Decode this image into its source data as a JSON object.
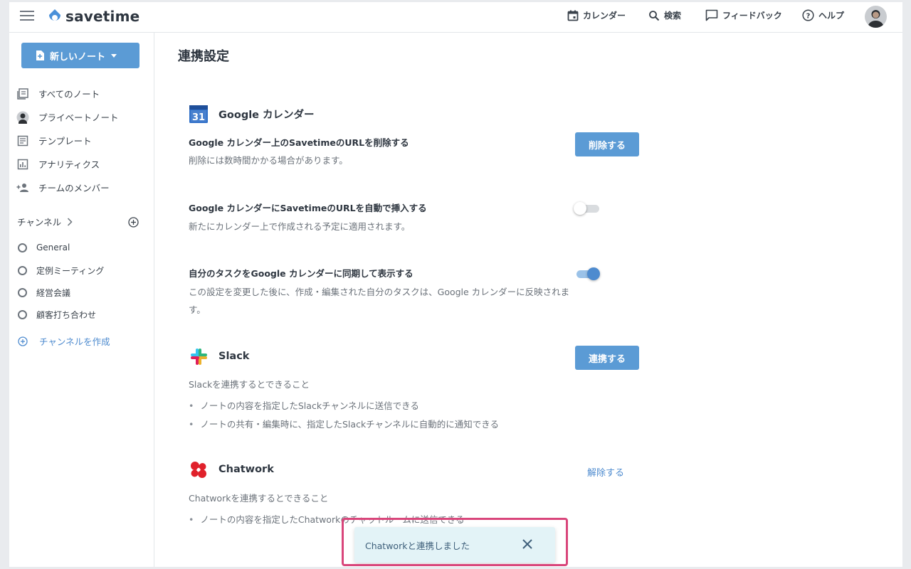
{
  "header": {
    "logo_text": "savetime",
    "nav": [
      {
        "label": "カレンダー",
        "icon": "calendar-icon"
      },
      {
        "label": "検索",
        "icon": "search-icon"
      },
      {
        "label": "フィードバック",
        "icon": "feedback-icon"
      },
      {
        "label": "ヘルプ",
        "icon": "help-icon"
      }
    ]
  },
  "sidebar": {
    "new_note_label": "新しいノート",
    "items": [
      {
        "label": "すべてのノート",
        "icon": "notes-icon"
      },
      {
        "label": "プライベートノート",
        "icon": "avatar-icon"
      },
      {
        "label": "テンプレート",
        "icon": "template-icon"
      },
      {
        "label": "アナリティクス",
        "icon": "analytics-icon"
      },
      {
        "label": "チームのメンバー",
        "icon": "add-member-icon"
      }
    ],
    "channels_label": "チャンネル",
    "channels": [
      "General",
      "定例ミーティング",
      "経営会議",
      "顧客打ち合わせ"
    ],
    "create_channel_label": "チャンネルを作成"
  },
  "main": {
    "title": "連携設定",
    "google": {
      "heading": "Google カレンダー",
      "icon_day": "31",
      "rows": [
        {
          "title": "Google カレンダー上のSavetimeのURLを削除する",
          "desc": "削除には数時間かかる場合があります。",
          "action": "削除する"
        },
        {
          "title": "Google カレンダーにSavetimeのURLを自動で挿入する",
          "desc": "新たにカレンダー上で作成される予定に適用されます。",
          "toggle": "off"
        },
        {
          "title": "自分のタスクをGoogle カレンダーに同期して表示する",
          "desc_line1": "この設定を変更した後に、作成・編集された自分のタスクは、Google カレンダーに反映されます。",
          "toggle": "on"
        }
      ]
    },
    "slack": {
      "heading": "Slack",
      "action": "連携する",
      "intro": "Slackを連携するとできること",
      "bullets": [
        "ノートの内容を指定したSlackチャンネルに送信できる",
        "ノートの共有・編集時に、指定したSlackチャンネルに自動的に通知できる"
      ]
    },
    "chatwork": {
      "heading": "Chatwork",
      "action": "解除する",
      "intro": "Chatworkを連携するとできること",
      "bullets": [
        "ノートの内容を指定したChatworkのチャットルームに送信できる"
      ]
    }
  },
  "toast": {
    "message": "Chatworkと連携しました"
  },
  "colors": {
    "accent": "#5b9bd5",
    "link": "#4e8bcf",
    "toast_bg": "#e3f3f7",
    "highlight": "#d9467b"
  }
}
